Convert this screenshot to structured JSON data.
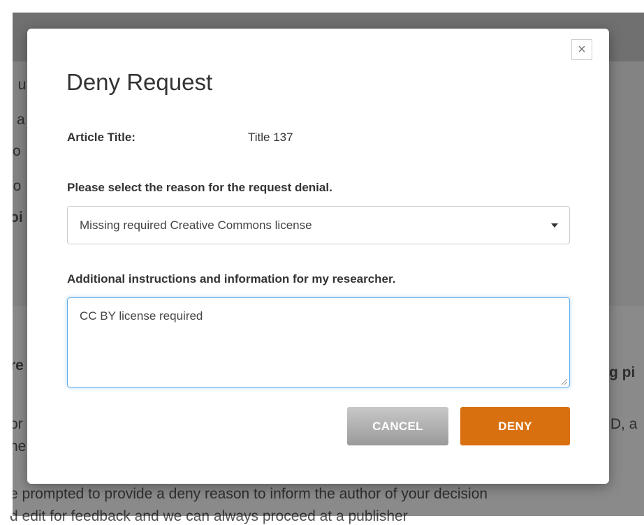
{
  "background": {
    "fragments": [
      ", u",
      "a",
      "o",
      "lo",
      "oi",
      "re",
      "g pi",
      "or",
      "ID, a",
      "he",
      "e prompted to provide a deny reason to inform the author of your decision",
      "d edit for feedback and we can always proceed at a publisher"
    ]
  },
  "modal": {
    "close_symbol": "×",
    "title": "Deny Request",
    "article_title_label": "Article Title:",
    "article_title_value": "Title 137",
    "reason_label": "Please select the reason for the request denial.",
    "reason_selected": "Missing required Creative Commons license",
    "instructions_label": "Additional instructions and information for my researcher.",
    "instructions_value": "CC BY license required",
    "cancel_label": "CANCEL",
    "deny_label": "DENY"
  },
  "colors": {
    "deny_button": "#d9700f",
    "focus_border": "#66afe9"
  }
}
